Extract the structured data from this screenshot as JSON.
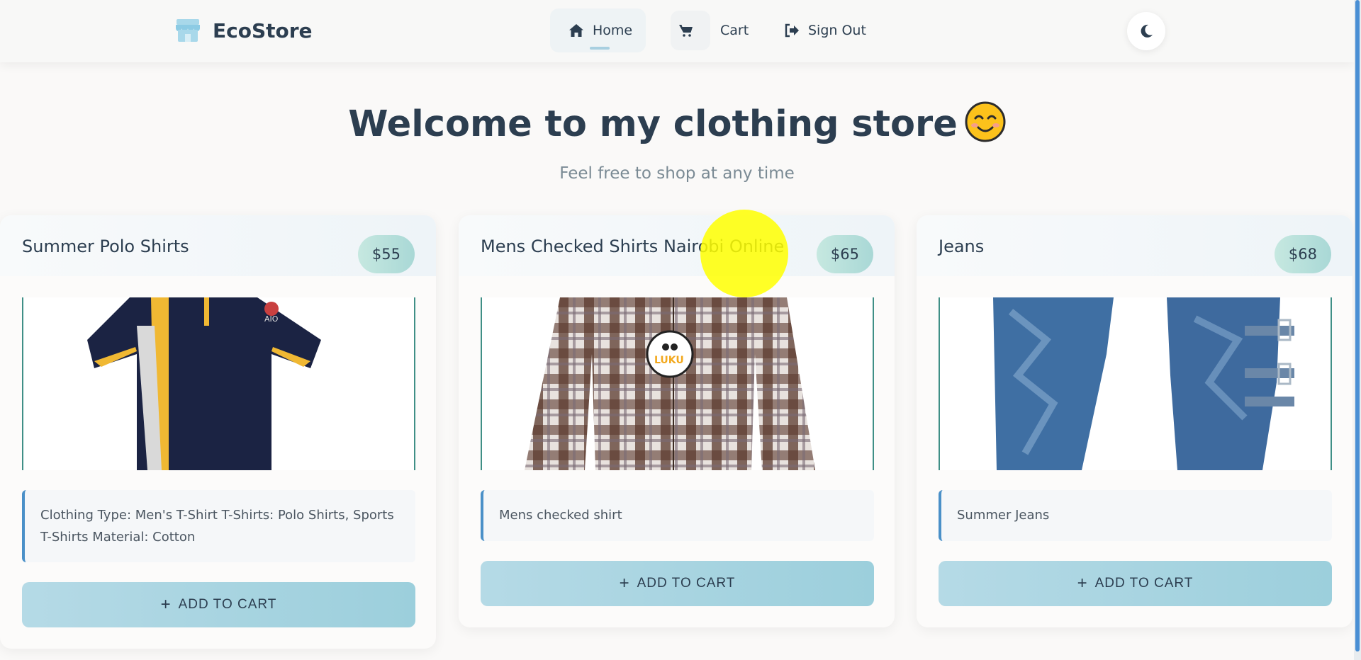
{
  "brand": {
    "name": "EcoStore",
    "icon": "store-icon"
  },
  "nav": {
    "home_label": "Home",
    "cart_label": "Cart",
    "signout_label": "Sign Out",
    "theme_icon": "moon-icon"
  },
  "hero": {
    "title": "Welcome to my clothing store",
    "emoji": "smiling-face-emoji",
    "subtitle": "Feel free to shop at any time"
  },
  "products": [
    {
      "title": "Summer Polo Shirts",
      "price": "$55",
      "image": "polo-shirt-image",
      "description": "Clothing Type: Men's T-Shirt T-Shirts: Polo Shirts, Sports T-Shirts Material: Cotton",
      "button_label": "ADD TO CART"
    },
    {
      "title": "Mens Checked Shirts Nairobi Online",
      "price": "$65",
      "image": "checked-shirt-image",
      "description": "Mens checked shirt",
      "button_label": "ADD TO CART"
    },
    {
      "title": "Jeans",
      "price": "$68",
      "image": "jeans-image",
      "description": "Summer Jeans",
      "button_label": "ADD TO CART"
    }
  ],
  "colors": {
    "accent": "#9ccfdc",
    "price_badge": "#a9d8d6",
    "text": "#2c3e50",
    "desc_border": "#4a90c8"
  }
}
